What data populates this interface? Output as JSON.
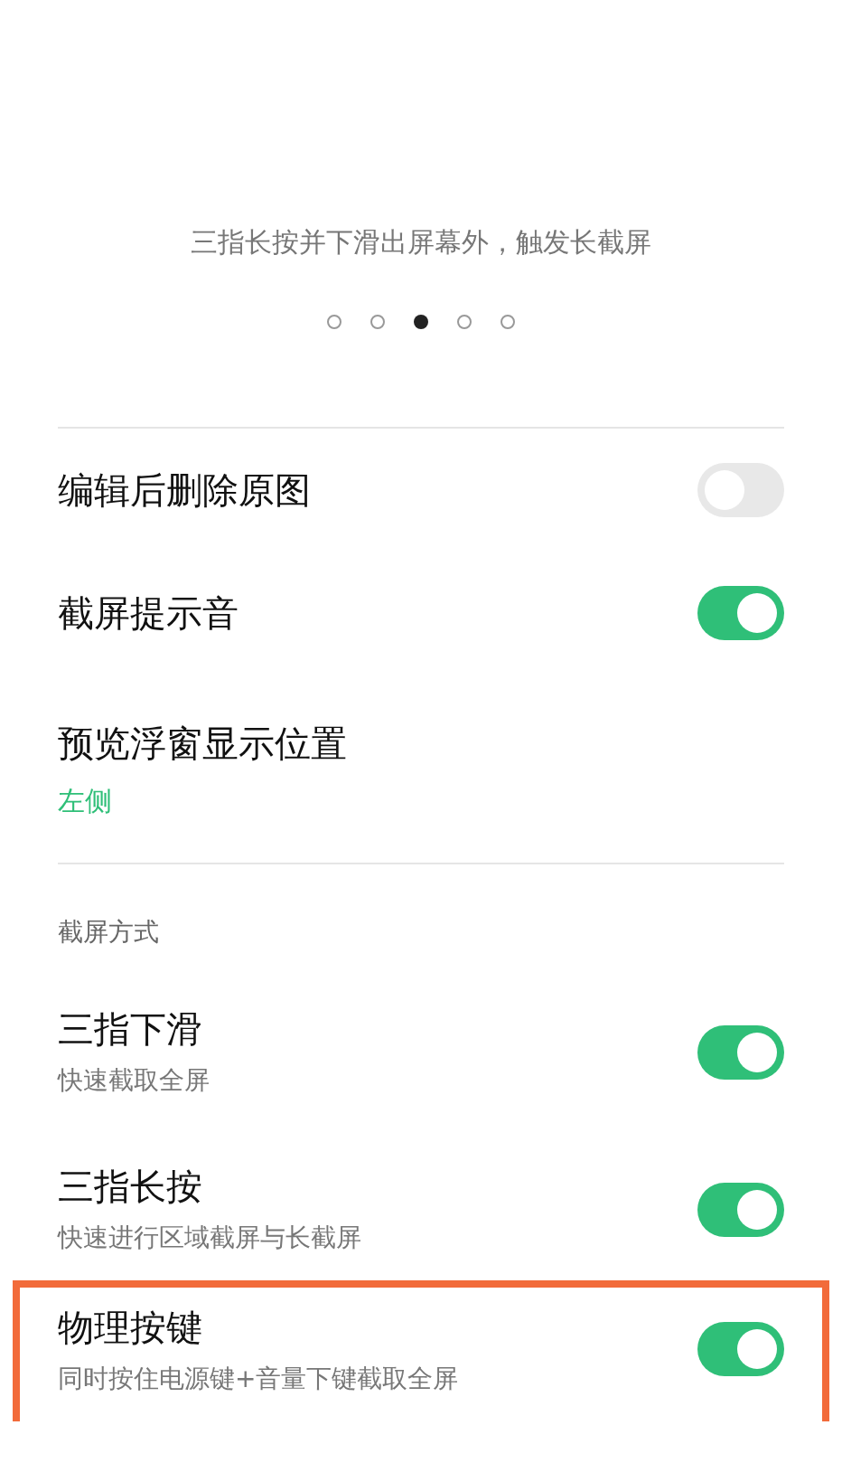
{
  "caption": "三指长按并下滑出屏幕外，触发长截屏",
  "pager": [
    {
      "selected": false
    },
    {
      "selected": false
    },
    {
      "selected": true
    },
    {
      "selected": false
    },
    {
      "selected": false
    }
  ],
  "settings": [
    {
      "kind": "toggle",
      "title": "编辑后删除原图",
      "on": false
    },
    {
      "kind": "toggle",
      "title": "截屏提示音",
      "on": true
    },
    {
      "kind": "value",
      "title": "预览浮窗显示位置",
      "value": "左侧"
    }
  ],
  "section": {
    "title": "截屏方式",
    "items": [
      {
        "title": "三指下滑",
        "subtitle": "快速截取全屏",
        "on": true,
        "highlighted": false
      },
      {
        "title": "三指长按",
        "subtitle": "快速进行区域截屏与长截屏",
        "on": true,
        "highlighted": false
      },
      {
        "title": "物理按键",
        "subtitle": "同时按住电源键+音量下键截取全屏",
        "on": true,
        "highlighted": true
      }
    ]
  }
}
